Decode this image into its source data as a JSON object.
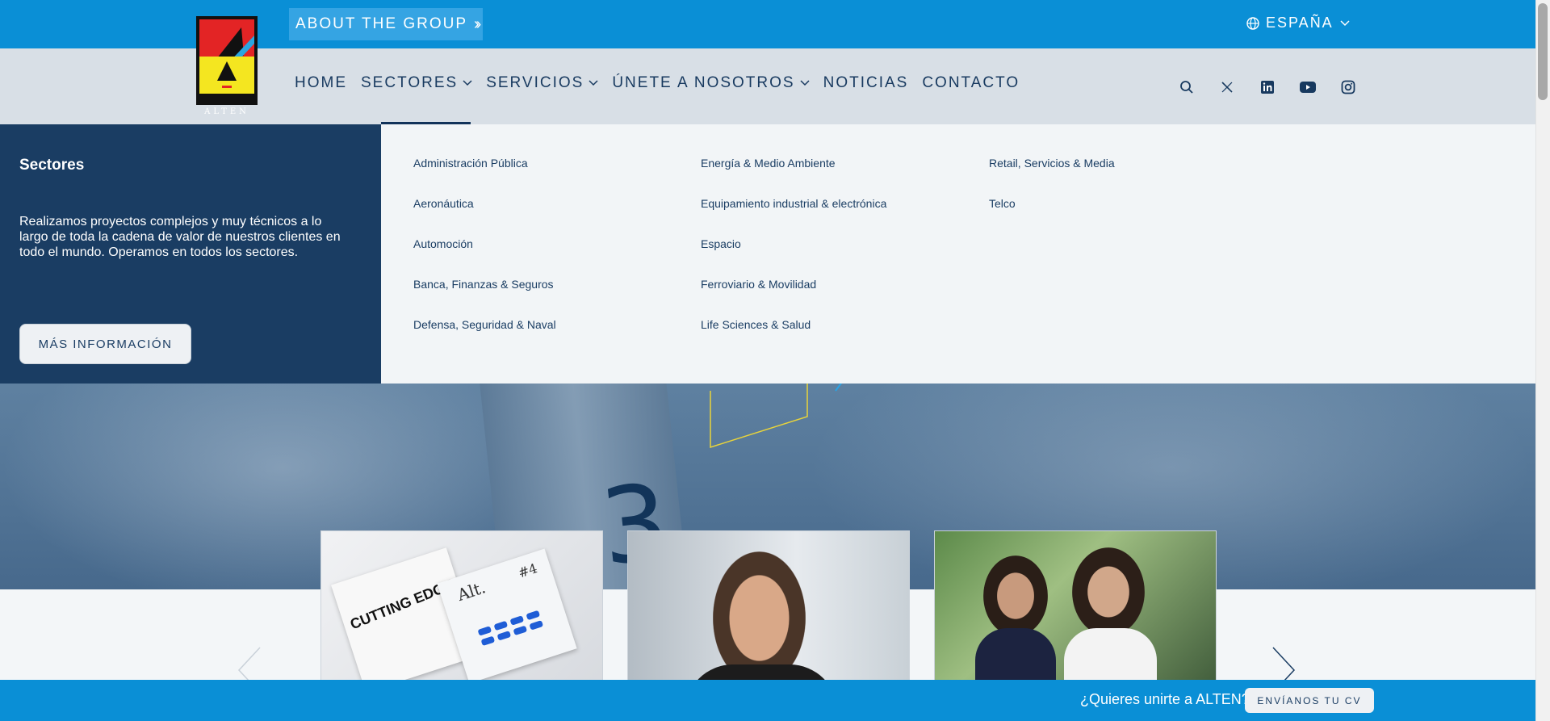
{
  "header": {
    "about_label": "ABOUT THE GROUP",
    "country_label": "ESPAÑA",
    "logo_text": "ALTEN"
  },
  "nav": {
    "items": [
      {
        "label": "HOME",
        "caret": false
      },
      {
        "label": "SECTORES",
        "caret": true
      },
      {
        "label": "SERVICIOS",
        "caret": true
      },
      {
        "label": "ÚNETE A NOSOTROS",
        "caret": true
      },
      {
        "label": "NOTICIAS",
        "caret": false
      },
      {
        "label": "CONTACTO",
        "caret": false
      }
    ],
    "icons": [
      "search-icon",
      "x-twitter-icon",
      "linkedin-icon",
      "youtube-icon",
      "instagram-icon"
    ]
  },
  "dropdown": {
    "title": "Sectores",
    "description": "Realizamos proyectos complejos y muy técnicos a lo largo de toda la cadena de valor de nuestros clientes en todo el mundo. Operamos en todos los sectores.",
    "button_label": "MÁS INFORMACIÓN",
    "columns": [
      [
        "Administración Pública",
        "Aeronáutica",
        "Automoción",
        "Banca, Finanzas & Seguros",
        "Defensa, Seguridad & Naval"
      ],
      [
        "Energía & Medio Ambiente",
        "Equipamiento industrial & electrónica",
        "Espacio",
        "Ferroviario & Movilidad",
        "Life Sciences & Salud"
      ],
      [
        "Retail, Servicios & Media",
        "Telco"
      ]
    ]
  },
  "cards": {
    "magazine_title": "Alt.",
    "magazine_issue": "#4",
    "magazine_cover": "CUTTING EDGE"
  },
  "footer": {
    "join_text": "¿Quieres unirte a ALTEN?",
    "cv_button": "ENVÍANOS TU CV"
  },
  "colors": {
    "brand_blue": "#0a8fd6",
    "navy": "#1a3d63",
    "logo_red": "#e32425",
    "logo_yellow": "#f4e620"
  }
}
